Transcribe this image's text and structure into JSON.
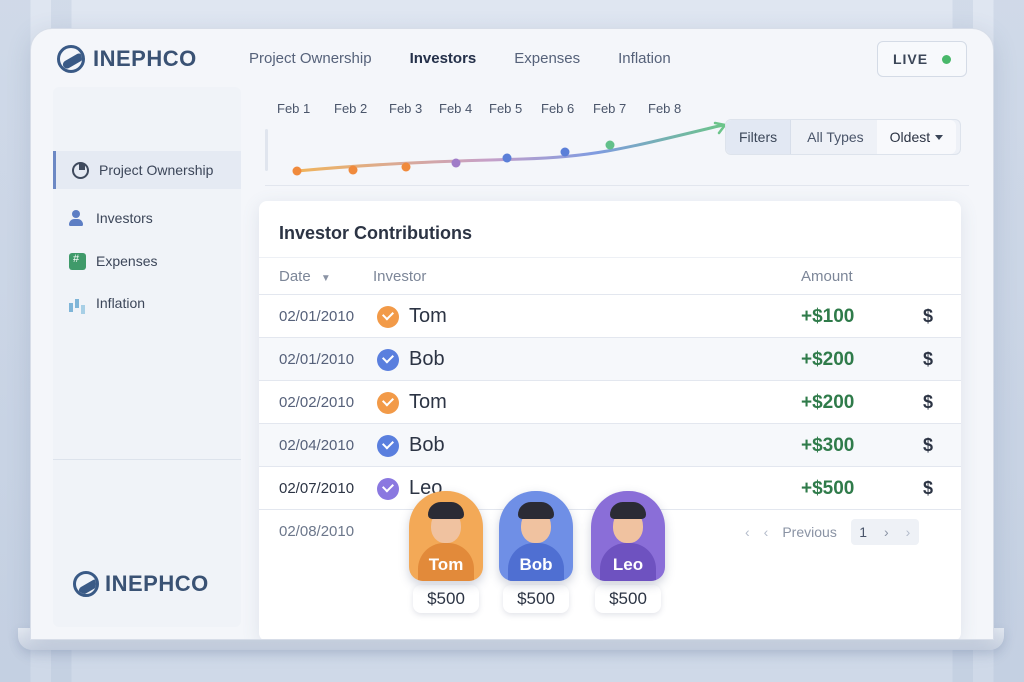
{
  "app": {
    "brand": "INEPHCO",
    "live_label": "LIVE"
  },
  "nav": [
    {
      "label": "Project Ownership",
      "active": false
    },
    {
      "label": "Investors",
      "active": true
    },
    {
      "label": "Expenses",
      "active": false
    },
    {
      "label": "Inflation",
      "active": false
    }
  ],
  "sidebar": {
    "items": [
      {
        "label": "Project Ownership",
        "icon": "pie-chart-icon",
        "active": true
      },
      {
        "label": "Investors",
        "icon": "user-icon",
        "active": false
      },
      {
        "label": "Expenses",
        "icon": "ledger-icon",
        "active": false
      },
      {
        "label": "Inflation",
        "icon": "bar-chart-icon",
        "active": false
      }
    ],
    "footer_brand": "INEPHCO"
  },
  "timeline": {
    "labels": [
      "Feb 1",
      "Feb 2",
      "Feb 3",
      "Feb 4",
      "Feb 5",
      "Feb 6",
      "Feb 7",
      "Feb 8"
    ],
    "point_colors": [
      "#f08a3c",
      "#f08a3c",
      "#f08a3c",
      "#a07cc8",
      "#5b7fd8",
      "#5b7fd8",
      "#62c08a"
    ]
  },
  "filters": {
    "filters_label": "Filters",
    "type_label": "All Types",
    "sort_label": "Oldest"
  },
  "table": {
    "title": "Investor Contributions",
    "columns": {
      "date": "Date",
      "investor": "Investor",
      "amount": "Amount"
    },
    "rows": [
      {
        "date": "02/01/2010",
        "investor": "Tom",
        "amount": "+$100",
        "currency": "$",
        "badge_color": "#f29a48"
      },
      {
        "date": "02/01/2010",
        "investor": "Bob",
        "amount": "+$200",
        "currency": "$",
        "badge_color": "#5a7fde"
      },
      {
        "date": "02/02/2010",
        "investor": "Tom",
        "amount": "+$200",
        "currency": "$",
        "badge_color": "#f29a48"
      },
      {
        "date": "02/04/2010",
        "investor": "Bob",
        "amount": "+$300",
        "currency": "$",
        "badge_color": "#5a7fde"
      },
      {
        "date": "02/07/2010",
        "investor": "Leo",
        "amount": "+$500",
        "currency": "$",
        "badge_color": "#8a78e0"
      }
    ],
    "footer_date": "02/08/2010",
    "pager": {
      "previous_label": "Previous",
      "page": "1"
    }
  },
  "avatars": [
    {
      "name": "Tom",
      "amount": "$500",
      "bg": "#f3a957",
      "shirt": "#e28a3a"
    },
    {
      "name": "Bob",
      "amount": "$500",
      "bg": "#6f8fe6",
      "shirt": "#4f6fd2"
    },
    {
      "name": "Leo",
      "amount": "$500",
      "bg": "#8a6ed8",
      "shirt": "#6e52c0"
    }
  ]
}
